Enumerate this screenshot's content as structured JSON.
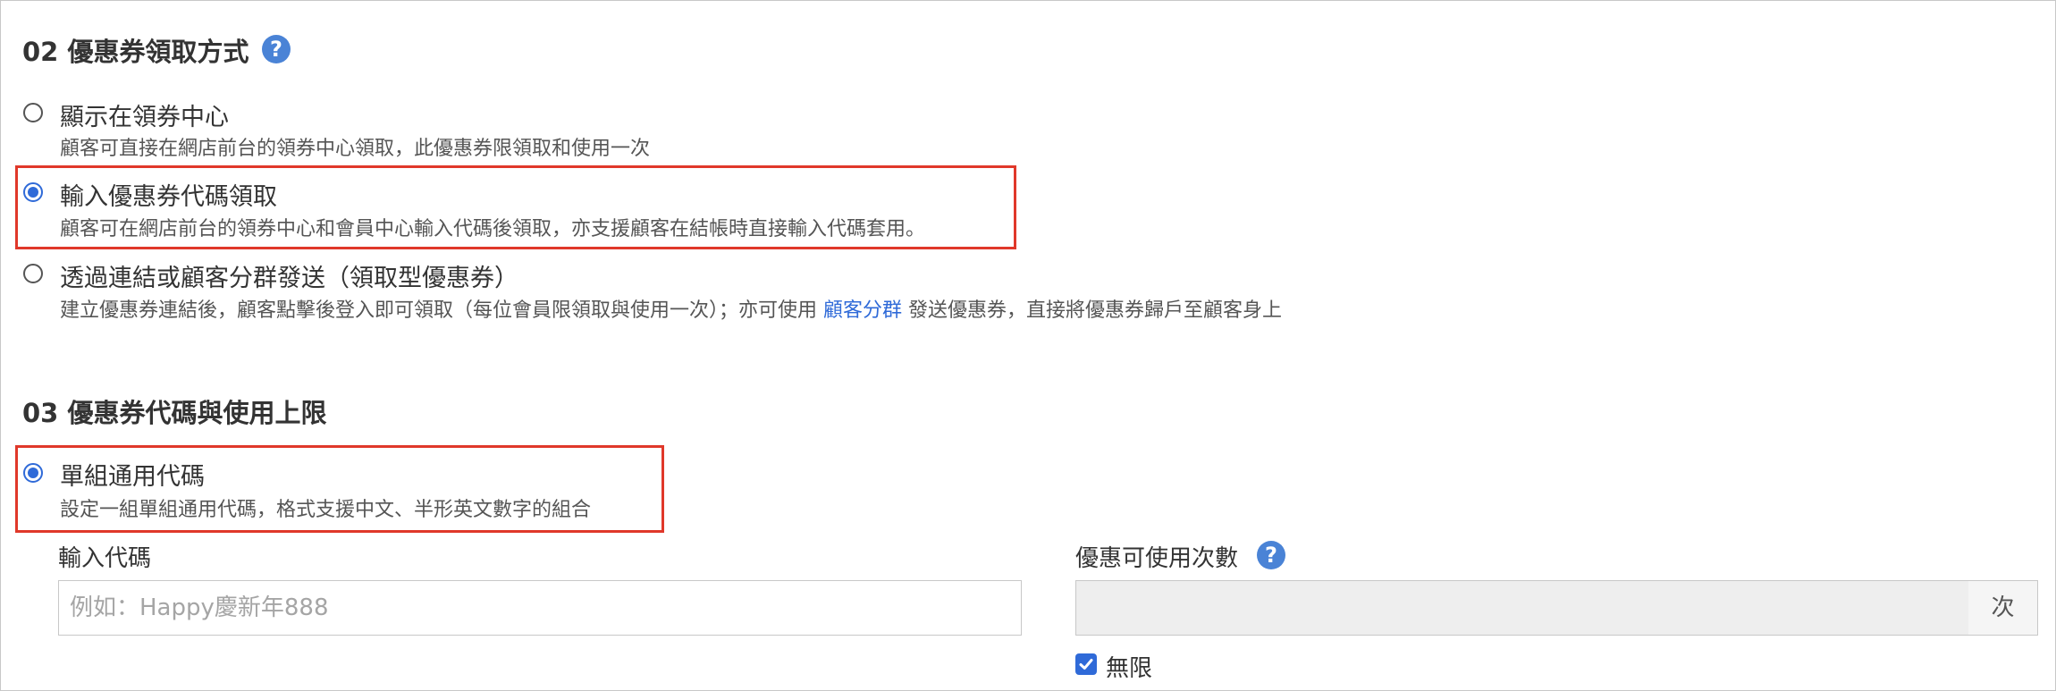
{
  "section02": {
    "title": "02 優惠券領取方式",
    "options": [
      {
        "label": "顯示在領券中心",
        "desc": "顧客可直接在網店前台的領券中心領取，此優惠券限領取和使用一次",
        "checked": false
      },
      {
        "label": "輸入優惠券代碼領取",
        "desc": "顧客可在網店前台的領券中心和會員中心輸入代碼後領取，亦支援顧客在結帳時直接輸入代碼套用。",
        "checked": true
      },
      {
        "label": "透過連結或顧客分群發送（領取型優惠券）",
        "desc_before": "建立優惠券連結後，顧客點擊後登入即可領取（每位會員限領取與使用一次）；亦可使用 ",
        "desc_link": "顧客分群",
        "desc_after": " 發送優惠券，直接將優惠券歸戶至顧客身上",
        "checked": false
      }
    ]
  },
  "section03": {
    "title": "03 優惠券代碼與使用上限",
    "option": {
      "label": "單組通用代碼",
      "desc": "設定一組單組通用代碼，格式支援中文、半形英文數字的組合",
      "checked": true
    },
    "code_field": {
      "label": "輸入代碼",
      "value": "",
      "placeholder": "例如：Happy慶新年888"
    },
    "usage_field": {
      "label": "優惠可使用次數",
      "value": "",
      "unit": "次"
    },
    "unlimited": {
      "label": "無限",
      "checked": true
    }
  },
  "icons": {
    "help": "question-circle-icon",
    "check": "checkmark-icon"
  },
  "colors": {
    "accent": "#2f6ad8",
    "help_icon": "#4a83d6",
    "highlight_border": "#e0382a"
  }
}
